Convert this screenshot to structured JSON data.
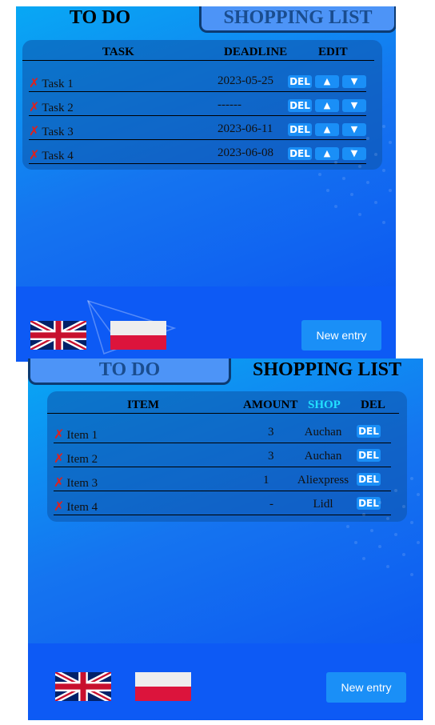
{
  "todo_panel": {
    "tabs": {
      "active": "TO DO",
      "inactive": "SHOPPING LIST"
    },
    "headers": {
      "task": "TASK",
      "deadline": "DEADLINE",
      "edit": "EDIT"
    },
    "rows": [
      {
        "mark": "✗",
        "task": "Task 1",
        "deadline": "2023-05-25",
        "del": "DEL",
        "up": "▲",
        "down": "▼"
      },
      {
        "mark": "✗",
        "task": "Task 2",
        "deadline": "------",
        "del": "DEL",
        "up": "▲",
        "down": "▼"
      },
      {
        "mark": "✗",
        "task": "Task 3",
        "deadline": "2023-06-11",
        "del": "DEL",
        "up": "▲",
        "down": "▼"
      },
      {
        "mark": "✗",
        "task": "Task 4",
        "deadline": "2023-06-08",
        "del": "DEL",
        "up": "▲",
        "down": "▼"
      }
    ],
    "new_entry": "New entry"
  },
  "shop_panel": {
    "tabs": {
      "inactive": "TO DO",
      "active": "SHOPPING LIST"
    },
    "headers": {
      "item": "ITEM",
      "amount": "AMOUNT",
      "shop": "SHOP",
      "del": "DEL"
    },
    "rows": [
      {
        "mark": "✗",
        "item": "Item 1",
        "amount": "3",
        "shop": "Auchan",
        "del": "DEL"
      },
      {
        "mark": "✗",
        "item": "Item 2",
        "amount": "3",
        "shop": "Auchan",
        "del": "DEL"
      },
      {
        "mark": "✗",
        "item": "Item 3",
        "amount": "1",
        "shop": "Aliexpress",
        "del": "DEL"
      },
      {
        "mark": "✗",
        "item": "Item 4",
        "amount": "-",
        "shop": "Lidl",
        "del": "DEL"
      }
    ],
    "new_entry": "New entry"
  },
  "colors": {
    "shop_header_accent": "#22e0ff",
    "delete_mark": "#e0201c",
    "button": "#1a8ff7"
  },
  "icons": {
    "english_flag": "uk-flag-icon",
    "polish_flag": "poland-flag-icon",
    "delete_mark": "cross-mark-icon"
  }
}
